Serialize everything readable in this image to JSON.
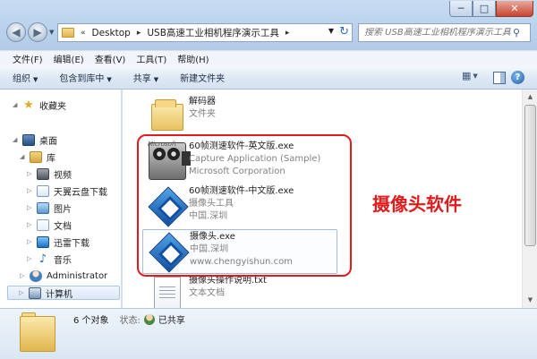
{
  "window": {
    "minimize_label": "─",
    "maximize_label": "□",
    "close_label": "✕"
  },
  "address": {
    "prefix": "«",
    "crumbs": [
      "Desktop",
      "USB高速工业相机程序演示工具"
    ],
    "separator": "▸"
  },
  "search": {
    "placeholder": "搜索 USB高速工业相机程序演示工具"
  },
  "menu": [
    "文件(F)",
    "编辑(E)",
    "查看(V)",
    "工具(T)",
    "帮助(H)"
  ],
  "toolbar": {
    "organize": "组织",
    "include_in_library": "包含到库中",
    "share": "共享",
    "new_folder": "新建文件夹",
    "help": "?"
  },
  "navigation": {
    "favorites": "收藏夹",
    "desktop": "桌面",
    "libraries": "库",
    "videos": "视频",
    "cloud": "天翼云盘下载",
    "pictures": "图片",
    "documents": "文档",
    "xunlei": "迅雷下载",
    "music": "音乐",
    "administrator": "Administrator",
    "computer": "计算机"
  },
  "files": [
    {
      "name": "解码器",
      "line2": "文件夹",
      "line3": ""
    },
    {
      "name": "60帧测速软件-英文版.exe",
      "line2": "Capture Application (Sample)",
      "line3": "Microsoft Corporation",
      "icon_tag": "Microsoft"
    },
    {
      "name": "60帧测速软件-中文版.exe",
      "line2": "摄像头工具",
      "line3": "中国.深圳"
    },
    {
      "name": "摄像头.exe",
      "line2": "中国.深圳",
      "line3": "www.chengyishun.com"
    },
    {
      "name": "摄像头操作说明.txt",
      "line2": "文本文档",
      "line3": ""
    }
  ],
  "annotation": "摄像头软件",
  "details": {
    "count": "6 个对象",
    "state_label": "状态:",
    "state_value": "已共享"
  },
  "colors": {
    "annotation_red": "#e11b1b",
    "frame_blue": "#b9d1ec"
  }
}
